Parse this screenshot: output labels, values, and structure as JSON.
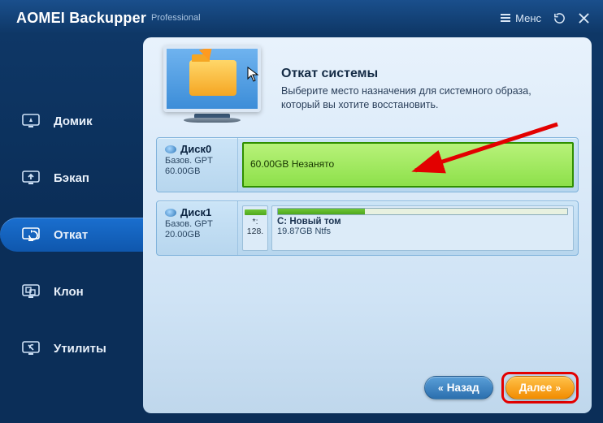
{
  "brand": {
    "name": "AOMEI Backupper",
    "edition": "Professional"
  },
  "titlebar": {
    "menu_label": "Менс"
  },
  "sidebar": {
    "items": [
      {
        "label": "Домик"
      },
      {
        "label": "Бэкап"
      },
      {
        "label": "Откат"
      },
      {
        "label": "Клон"
      },
      {
        "label": "Утилиты"
      }
    ]
  },
  "page": {
    "title": "Откат системы",
    "desc": "Выберите место назначения для системного образа, который вы хотите восстановить."
  },
  "disks": [
    {
      "name": "Диск0",
      "type_line": "Базов. GPT",
      "size": "60.00GB",
      "partitions": [
        {
          "label": "60.00GB Незанято"
        }
      ]
    },
    {
      "name": "Диск1",
      "type_line": "Базов. GPT",
      "size": "20.00GB",
      "partitions_small": {
        "label1": "*:",
        "label2": "128."
      },
      "partitions_big": {
        "name": "C: Новый том",
        "detail": "19.87GB Ntfs"
      }
    }
  ],
  "footer": {
    "back": "Назад",
    "next": "Далее"
  }
}
